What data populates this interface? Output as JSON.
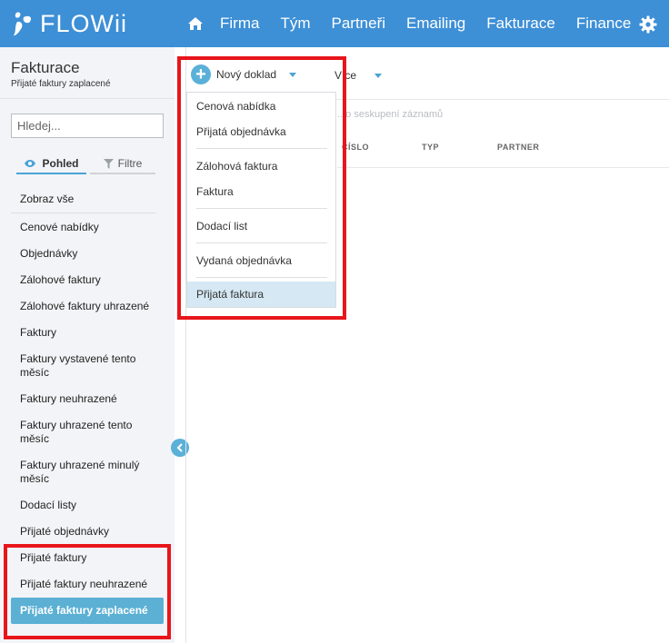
{
  "app": {
    "logo_text": "FLOWii"
  },
  "nav": {
    "home_icon": "home-icon",
    "items": [
      "Firma",
      "Tým",
      "Partneři",
      "Emailing",
      "Fakturace",
      "Finance"
    ],
    "settings_icon": "gear-icon"
  },
  "sidebar": {
    "title": "Fakturace",
    "subtitle": "Přijaté faktury zaplacené",
    "search_placeholder": "Hledej...",
    "tabs": {
      "pohled": "Pohled",
      "filtre": "Filtre"
    },
    "items": [
      "Zobraz vše",
      "Cenové nabídky",
      "Objednávky",
      "Zálohové faktury",
      "Zálohové faktury uhrazené",
      "Faktury",
      "Faktury vystavené tento měsíc",
      "Faktury neuhrazené",
      "Faktury uhrazené tento měsíc",
      "Faktury uhrazené minulý měsíc",
      "Dodací listy",
      "Přijaté objednávky",
      "Přijaté faktury",
      "Přijaté faktury neuhrazené"
    ],
    "active_item": "Přijaté faktury zaplacené"
  },
  "toolbar": {
    "new_label": "Nový doklad",
    "more_label": "Více"
  },
  "table": {
    "group_hint": "...o seskupení záznamů",
    "columns": [
      "ČÍSLO",
      "TYP",
      "PARTNER"
    ]
  },
  "dropdown": {
    "items": [
      "Cenová nabídka",
      "Přijatá objednávka",
      "Zálohová faktura",
      "Faktura",
      "Dodací list",
      "Vydaná objednávka",
      "Přijatá faktura"
    ],
    "highlighted": "Přijatá faktura"
  },
  "colors": {
    "topbar": "#3d8fd6",
    "accent": "#5ab0d8",
    "highlight_box": "#e8151b"
  }
}
